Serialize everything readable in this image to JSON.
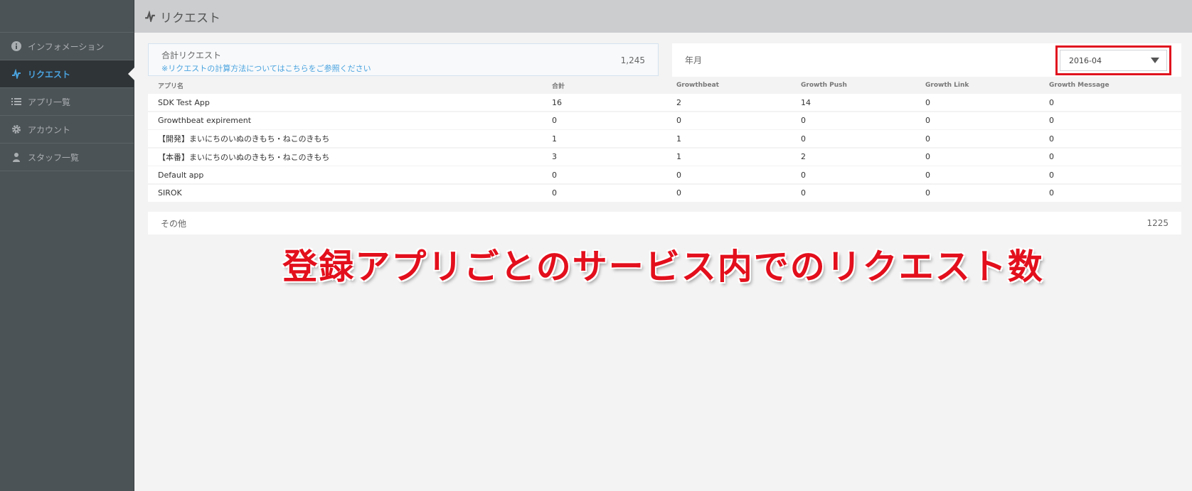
{
  "header": {
    "title": "リクエスト",
    "title_icon": "activity-icon"
  },
  "sidebar": {
    "items": [
      {
        "label": "インフォメーション",
        "icon": "info-icon",
        "active": false
      },
      {
        "label": "リクエスト",
        "icon": "activity-icon",
        "active": true
      },
      {
        "label": "アプリ一覧",
        "icon": "list-icon",
        "active": false
      },
      {
        "label": "アカウント",
        "icon": "gear-icon",
        "active": false
      },
      {
        "label": "スタッフ一覧",
        "icon": "user-icon",
        "active": false
      }
    ]
  },
  "summary": {
    "label": "合計リクエスト",
    "note": "※リクエストの計算方法についてはこちらをご参照ください",
    "value": "1,245"
  },
  "month_filter": {
    "label": "年月",
    "selected": "2016-04"
  },
  "table": {
    "headers": [
      "アプリ名",
      "合計",
      "Growthbeat",
      "Growth Push",
      "Growth Link",
      "Growth Message"
    ],
    "rows": [
      [
        "SDK Test App",
        "16",
        "2",
        "14",
        "0",
        "0"
      ],
      [
        "Growthbeat expirement",
        "0",
        "0",
        "0",
        "0",
        "0"
      ],
      [
        "【開発】まいにちのいぬのきもち・ねこのきもち",
        "1",
        "1",
        "0",
        "0",
        "0"
      ],
      [
        "【本番】まいにちのいぬのきもち・ねこのきもち",
        "3",
        "1",
        "2",
        "0",
        "0"
      ],
      [
        "Default app",
        "0",
        "0",
        "0",
        "0",
        "0"
      ],
      [
        "SIROK",
        "0",
        "0",
        "0",
        "0",
        "0"
      ]
    ]
  },
  "other": {
    "label": "その他",
    "value": "1225"
  },
  "annotation": "登録アプリごとのサービス内でのリクエスト数",
  "colors": {
    "accent": "#4aa3df",
    "highlight": "#e0121e",
    "sidebar": "#4c5356"
  }
}
